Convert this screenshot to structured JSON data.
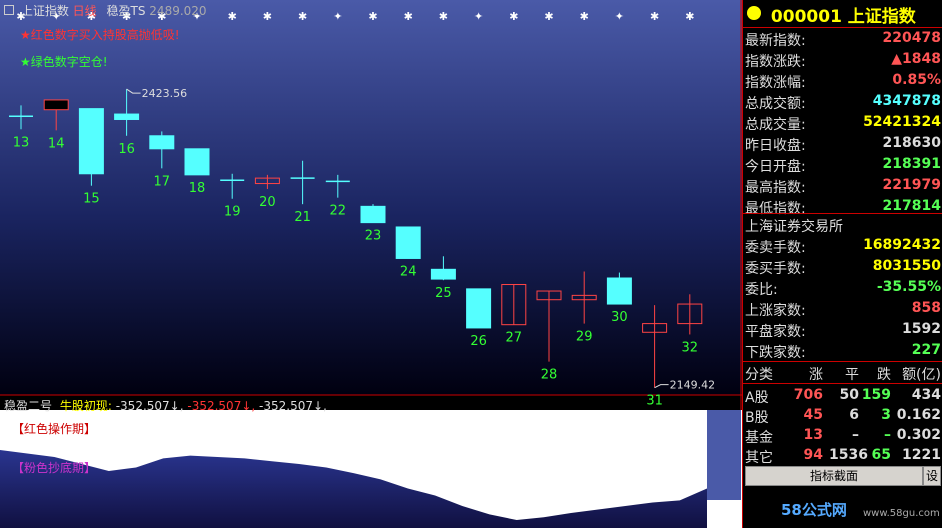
{
  "header": {
    "index_name": "上证指数",
    "period": "日线",
    "indicator_name": "稳盈TS",
    "indicator_value": "2489.020"
  },
  "notes": {
    "red_note": "★红色数字买入持股高抛低吸!",
    "green_note": "★绿色数字空仓!"
  },
  "sub_chart": {
    "indicator_name": "稳盈二号",
    "signal_label": "牛股初现:",
    "value1": "-352.507↓,",
    "value2": "-352.507↓,",
    "value3": "-352.507↓,",
    "red_phase_label": "【红色操作期】",
    "pink_phase_label": "【粉色抄底期】"
  },
  "chart_data": {
    "type": "candlestick",
    "title": "上证指数 日线",
    "categories": [
      "13",
      "14",
      "15",
      "16",
      "17",
      "18",
      "19",
      "20",
      "21",
      "22",
      "23",
      "24",
      "25",
      "26",
      "27",
      "28",
      "29",
      "30",
      "31",
      "32"
    ],
    "ohlc": [
      {
        "label": "13",
        "open": 2399,
        "high": 2409,
        "low": 2387,
        "close": 2399,
        "color": "cyan"
      },
      {
        "label": "14",
        "open": 2405,
        "high": 2414,
        "low": 2386,
        "close": 2414,
        "color": "red"
      },
      {
        "label": "15",
        "open": 2406,
        "high": 2406,
        "low": 2335,
        "close": 2346,
        "color": "cyan"
      },
      {
        "label": "16",
        "open": 2396,
        "high": 2424,
        "low": 2381,
        "close": 2401,
        "color": "cyan"
      },
      {
        "label": "17",
        "open": 2381,
        "high": 2385,
        "low": 2351,
        "close": 2369,
        "color": "cyan"
      },
      {
        "label": "18",
        "open": 2369,
        "high": 2369,
        "low": 2345,
        "close": 2345,
        "color": "cyan"
      },
      {
        "label": "19",
        "open": 2340,
        "high": 2346,
        "low": 2323,
        "close": 2340,
        "color": "cyan"
      },
      {
        "label": "20",
        "open": 2337,
        "high": 2345,
        "low": 2332,
        "close": 2342,
        "color": "red"
      },
      {
        "label": "21",
        "open": 2342,
        "high": 2358,
        "low": 2318,
        "close": 2342,
        "color": "cyan"
      },
      {
        "label": "22",
        "open": 2339,
        "high": 2345,
        "low": 2324,
        "close": 2339,
        "color": "cyan"
      },
      {
        "label": "23",
        "open": 2316,
        "high": 2318,
        "low": 2301,
        "close": 2301,
        "color": "cyan"
      },
      {
        "label": "24",
        "open": 2297,
        "high": 2297,
        "low": 2268,
        "close": 2268,
        "color": "cyan"
      },
      {
        "label": "25",
        "open": 2258,
        "high": 2270,
        "low": 2248,
        "close": 2249,
        "color": "cyan"
      },
      {
        "label": "26",
        "open": 2240,
        "high": 2240,
        "low": 2204,
        "close": 2204,
        "color": "cyan"
      },
      {
        "label": "27",
        "open": 2207,
        "high": 2244,
        "low": 2207,
        "close": 2244,
        "color": "red"
      },
      {
        "label": "28",
        "open": 2230,
        "high": 2238,
        "low": 2173,
        "close": 2238,
        "color": "red"
      },
      {
        "label": "29",
        "open": 2230,
        "high": 2256,
        "low": 2208,
        "close": 2234,
        "color": "red"
      },
      {
        "label": "30",
        "open": 2250,
        "high": 2255,
        "low": 2226,
        "close": 2226,
        "color": "cyan"
      },
      {
        "label": "31",
        "open": 2200,
        "high": 2225,
        "low": 2149,
        "close": 2208,
        "color": "red"
      },
      {
        "label": "32",
        "open": 2208,
        "high": 2235,
        "low": 2198,
        "close": 2226,
        "color": "red"
      }
    ],
    "annotations": {
      "high": "2423.56",
      "low": "2149.42"
    },
    "ylim": [
      2145,
      2495
    ],
    "sub_series_baseline": [
      0.0,
      0.05,
      0.1,
      0.2,
      0.3,
      0.25,
      0.12,
      0.08,
      0.1,
      0.12,
      0.16,
      0.2,
      0.25,
      0.33,
      0.42,
      0.55,
      0.65,
      0.8,
      0.92,
      1.0,
      0.96,
      0.9,
      0.85,
      0.8,
      0.75,
      0.72,
      0.55
    ]
  },
  "side": {
    "title": "000001 上证指数",
    "rows": [
      {
        "label": "最新指数:",
        "value": "220478",
        "color": "#ff5555"
      },
      {
        "label": "指数涨跌:",
        "value": "▲1848",
        "color": "#ff5555"
      },
      {
        "label": "指数涨幅:",
        "value": "0.85%",
        "color": "#ff5555"
      },
      {
        "label": "总成交额:",
        "value": "4347878",
        "color": "#55ffff"
      },
      {
        "label": "总成交量:",
        "value": "52421324",
        "color": "#ffff00"
      },
      {
        "label": "昨日收盘:",
        "value": "218630",
        "color": "#dddddd"
      },
      {
        "label": "今日开盘:",
        "value": "218391",
        "color": "#55ff55"
      },
      {
        "label": "最高指数:",
        "value": "221979",
        "color": "#ff5555"
      },
      {
        "label": "最低指数:",
        "value": "217814",
        "color": "#55ff55"
      }
    ],
    "exchange": "上海证券交易所",
    "rows2": [
      {
        "label": "委卖手数:",
        "value": "16892432",
        "color": "#ffff00"
      },
      {
        "label": "委买手数:",
        "value": "8031550",
        "color": "#ffff00"
      },
      {
        "label": "委比:",
        "value": "-35.55%",
        "color": "#55ff55"
      },
      {
        "label": "上涨家数:",
        "value": "858",
        "color": "#ff5555"
      },
      {
        "label": "平盘家数:",
        "value": "1592",
        "color": "#dddddd"
      },
      {
        "label": "下跌家数:",
        "value": "227",
        "color": "#55ff55"
      }
    ],
    "table_header": [
      "分类",
      "涨",
      "平",
      "跌",
      "额(亿)"
    ],
    "table_rows": [
      {
        "cat": "A股",
        "up": "706",
        "flat": "50",
        "down": "159",
        "amt": "434"
      },
      {
        "cat": "B股",
        "up": "45",
        "flat": "6",
        "down": "3",
        "amt": "0.162"
      },
      {
        "cat": "基金",
        "up": "13",
        "flat": "–",
        "down": "–",
        "amt": "0.302"
      },
      {
        "cat": "其它",
        "up": "94",
        "flat": "1536",
        "down": "65",
        "amt": "1221"
      }
    ],
    "button_label": "指标截面",
    "settings_label": "设",
    "watermark": "58公式网",
    "watermark_url": "www.58gu.com"
  }
}
